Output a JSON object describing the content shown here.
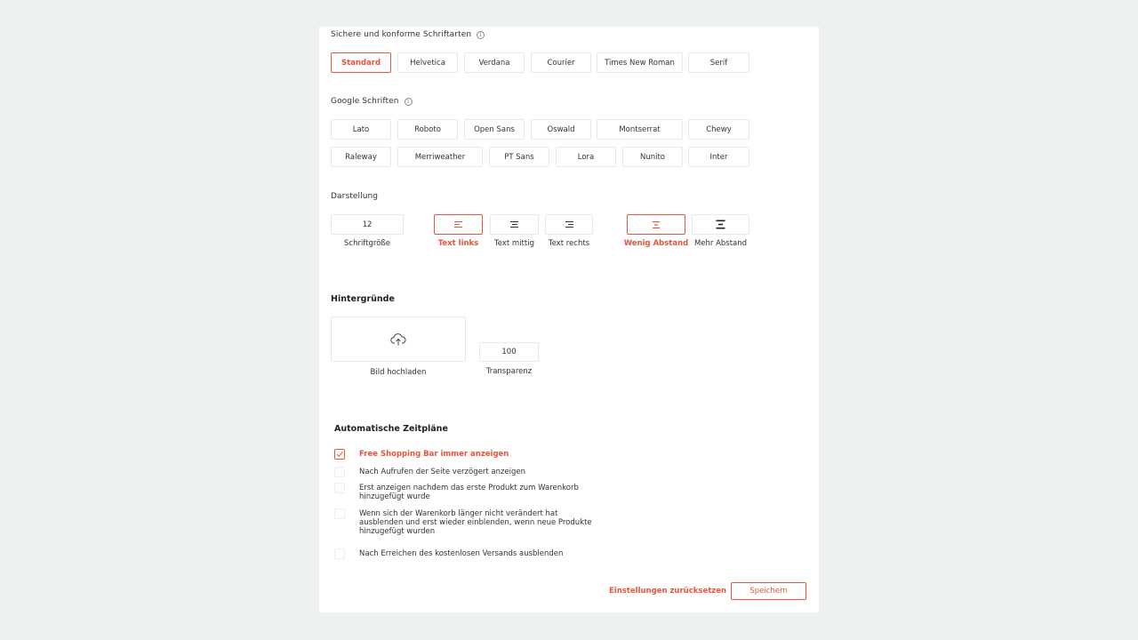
{
  "colors": {
    "accent": "#e8553c",
    "background": "#eef1f1",
    "border": "#e6e9ea"
  },
  "safe_fonts": {
    "label": "Sichere und konforme Schriftarten",
    "info_icon": "info-icon",
    "options": [
      "Standard",
      "Helvetica",
      "Verdana",
      "Courier",
      "Times New Roman",
      "Serif"
    ],
    "selected": "Standard"
  },
  "google_fonts": {
    "label": "Google Schriften",
    "info_icon": "info-icon",
    "row1": [
      "Lato",
      "Roboto",
      "Open Sans",
      "Oswald",
      "Montserrat",
      "Chewy"
    ],
    "row2": [
      "Raleway",
      "Merriweather",
      "PT Sans",
      "Lora",
      "Nunito",
      "Inter"
    ]
  },
  "display": {
    "label": "Darstellung",
    "font_size": {
      "value": "12",
      "caption": "Schriftgröße"
    },
    "alignment": [
      {
        "icon": "align-left-icon",
        "caption": "Text links",
        "selected": true
      },
      {
        "icon": "align-center-icon",
        "caption": "Text mittig",
        "selected": false
      },
      {
        "icon": "align-right-icon",
        "caption": "Text rechts",
        "selected": false
      }
    ],
    "spacing": [
      {
        "icon": "spacing-small-icon",
        "caption": "Wenig Abstand",
        "selected": true
      },
      {
        "icon": "spacing-large-icon",
        "caption": "Mehr Abstand",
        "selected": false
      }
    ]
  },
  "backgrounds": {
    "title": "Hintergründe",
    "upload": {
      "icon": "cloud-upload-icon",
      "caption": "Bild hochladen"
    },
    "transparency": {
      "value": "100",
      "caption": "Transparenz"
    }
  },
  "schedules": {
    "title": "Automatische Zeitpläne",
    "options": [
      {
        "label": "Free Shopping Bar immer anzeigen",
        "checked": true
      },
      {
        "label": "Nach Aufrufen der Seite verzögert anzeigen",
        "checked": false
      },
      {
        "label": "Erst anzeigen nachdem das erste Produkt zum Warenkorb hinzugefügt wurde",
        "checked": false
      },
      {
        "label": "Wenn sich der Warenkorb länger nicht verändert hat ausblenden und erst wieder einblenden, wenn neue Produkte hinzugefügt wurden",
        "checked": false
      },
      {
        "label": "Nach Erreichen des kostenlosen Versands ausblenden",
        "checked": false
      }
    ]
  },
  "footer": {
    "reset_label": "Einstellungen zurücksetzen",
    "save_label": "Speichern"
  }
}
